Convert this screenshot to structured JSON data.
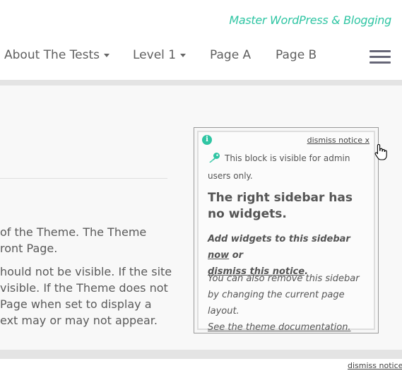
{
  "header": {
    "tagline": "Master WordPress & Blogging"
  },
  "nav": {
    "items": [
      {
        "label": "About The Tests",
        "has_dropdown": true
      },
      {
        "label": "Level 1",
        "has_dropdown": true
      },
      {
        "label": "Page A",
        "has_dropdown": false
      },
      {
        "label": "Page B",
        "has_dropdown": false
      }
    ],
    "menu_icon": "hamburger-menu-icon"
  },
  "content": {
    "paragraph1": [
      "of the Theme. The Theme",
      "ront Page."
    ],
    "paragraph2": [
      "hould not be visible. If the site",
      " visible. If the Theme does not",
      " Page when set to display a",
      "ext may or may not appear."
    ]
  },
  "notice": {
    "dismiss_label": "dismiss notice x",
    "admin_text_1": "This block is visible for admin",
    "admin_text_2": "users only.",
    "title": "The right sidebar has no widgets.",
    "add_prefix": "Add widgets to this sidebar ",
    "add_now": "now",
    "add_or": " or",
    "add_dismiss": "dismiss this notice",
    "add_period": ".",
    "remove_text": "You can also remove this sidebar by changing the current page layout.",
    "doc_link": "See the theme documentation.",
    "colors": {
      "accent": "#2fc5a3"
    }
  },
  "footer_notice": {
    "dismiss_label": "dismiss notice"
  }
}
